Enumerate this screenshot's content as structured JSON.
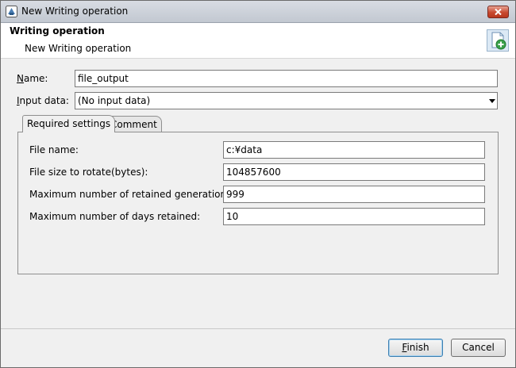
{
  "window": {
    "title": "New Writing operation"
  },
  "header": {
    "title": "Writing operation",
    "subtitle": "New Writing operation"
  },
  "form": {
    "name_label_mnemonic": "N",
    "name_label_rest": "ame:",
    "name_value": "file_output",
    "input_label_mnemonic": "I",
    "input_label_rest": "nput data:",
    "input_value": "(No input data)"
  },
  "tabs": [
    {
      "label": "Required settings"
    },
    {
      "label": "Comment"
    }
  ],
  "settings": {
    "file_name_label": "File name:",
    "file_name_value": "c:¥data",
    "rotate_label": "File size to rotate(bytes):",
    "rotate_value": "104857600",
    "generations_label": "Maximum number of retained generations:",
    "generations_value": "999",
    "days_label": "Maximum number of days retained:",
    "days_value": "10"
  },
  "buttons": {
    "finish_mnemonic": "F",
    "finish_rest": "inish",
    "cancel_label": "Cancel"
  },
  "colors": {
    "accent": "#3c7fb1",
    "close_button": "#c8492f"
  },
  "icons": {
    "app": "app-window-icon",
    "close": "close-icon",
    "header": "document-add-icon"
  }
}
